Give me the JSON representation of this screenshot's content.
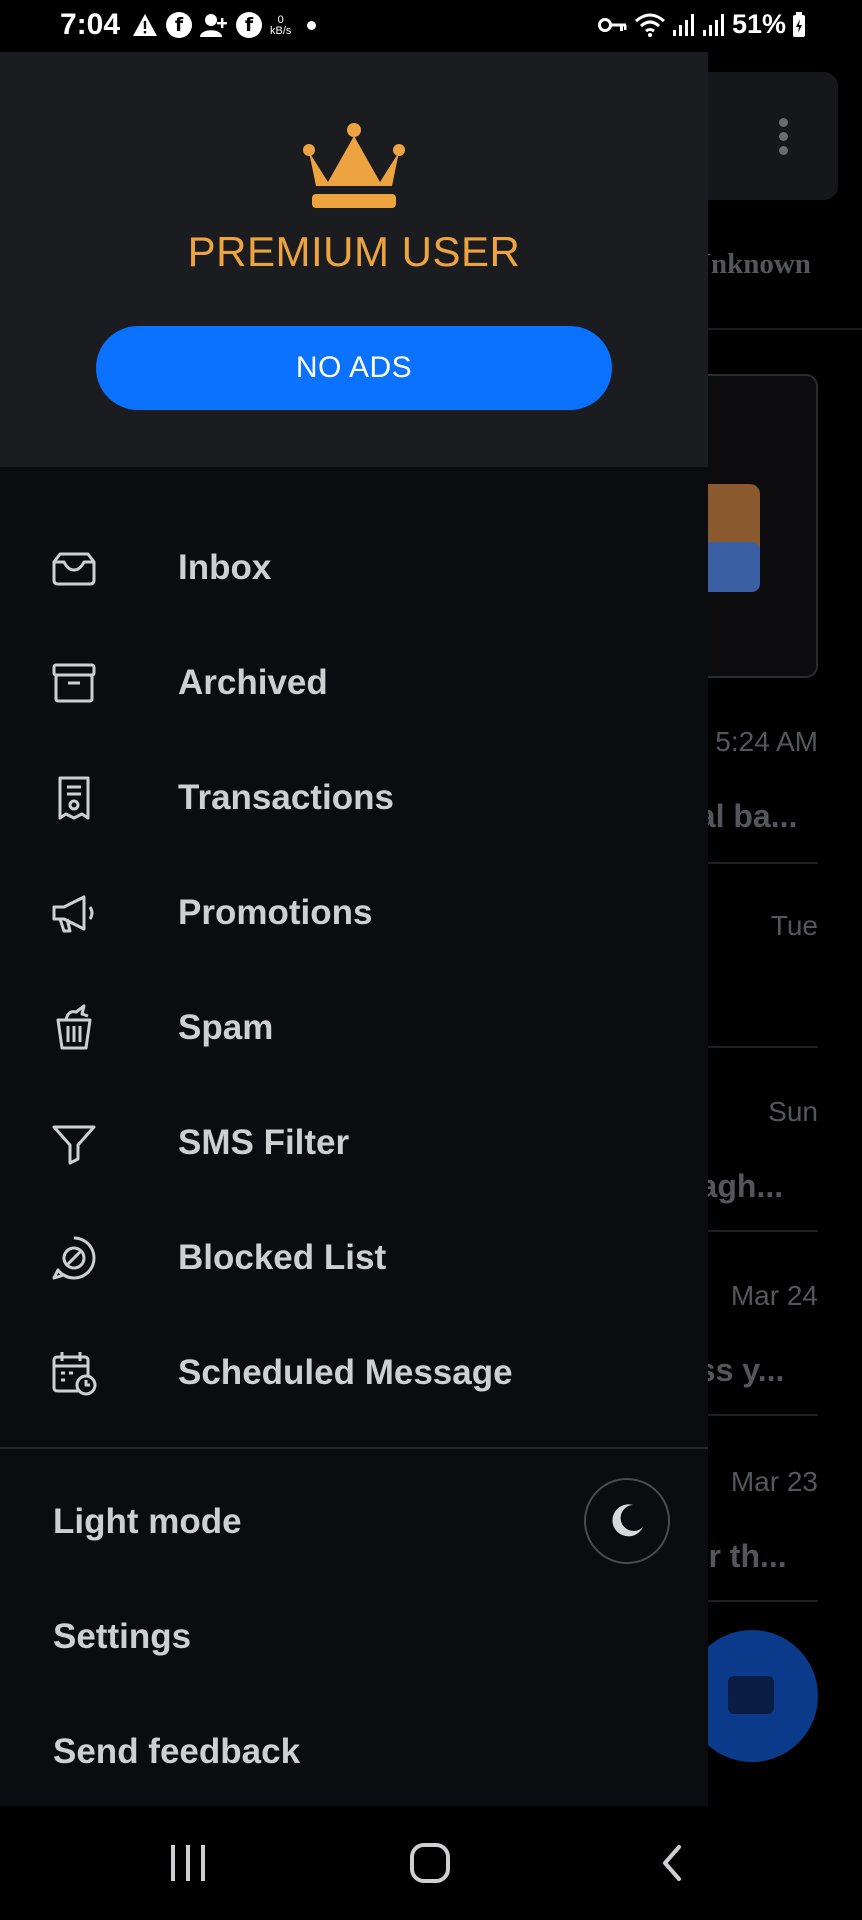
{
  "status_bar": {
    "time": "7:04",
    "left_icons": [
      "warning-icon",
      "facebook-icon",
      "add-contact-icon",
      "facebook-icon"
    ],
    "data_speed": "0",
    "data_unit": "kB/s",
    "right_icons": [
      "vpn-key-icon",
      "wifi-icon",
      "signal-icon",
      "signal-icon"
    ],
    "battery": "51%"
  },
  "drawer": {
    "header": {
      "badge_icon": "crown-icon",
      "title": "PREMIUM USER",
      "button_label": "NO ADS",
      "colors": {
        "title": "#eda440",
        "button": "#0a72ff"
      }
    },
    "menu": [
      {
        "label": "Inbox",
        "icon": "inbox-icon"
      },
      {
        "label": "Archived",
        "icon": "archive-icon"
      },
      {
        "label": "Transactions",
        "icon": "receipt-icon"
      },
      {
        "label": "Promotions",
        "icon": "megaphone-icon"
      },
      {
        "label": "Spam",
        "icon": "spam-bin-icon"
      },
      {
        "label": "SMS Filter",
        "icon": "filter-icon"
      },
      {
        "label": "Blocked List",
        "icon": "blocked-icon"
      },
      {
        "label": "Scheduled Message",
        "icon": "calendar-clock-icon"
      }
    ],
    "footer": {
      "light_mode": "Light mode",
      "toggle_icon": "moon-icon",
      "settings": "Settings",
      "feedback": "Send feedback"
    }
  },
  "background": {
    "tab_label": "Unknown",
    "conversations": [
      {
        "time": "5:24 AM",
        "snippet": "cal ba..."
      },
      {
        "time": "Tue",
        "snippet": ""
      },
      {
        "time": "Sun",
        "snippet": "pagh..."
      },
      {
        "time": "Mar 24",
        "snippet": "ess y..."
      },
      {
        "time": "Mar 23",
        "snippet": "ter th..."
      }
    ],
    "fab_icon": "message-icon"
  },
  "nav_bar": {
    "recents": "recents-icon",
    "home": "home-icon",
    "back": "back-icon"
  }
}
